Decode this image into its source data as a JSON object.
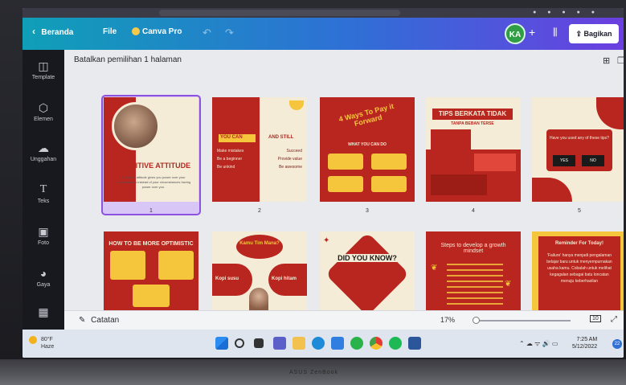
{
  "topbar": {
    "home_label": "Beranda",
    "file_label": "File",
    "pro_label": "Canva Pro",
    "avatar_initials": "KA",
    "share_label": "Bagikan"
  },
  "sidebar": {
    "items": [
      {
        "label": "Template",
        "icon": "layout-icon"
      },
      {
        "label": "Elemen",
        "icon": "shapes-icon"
      },
      {
        "label": "Unggahan",
        "icon": "upload-icon"
      },
      {
        "label": "Teks",
        "icon": "text-icon"
      },
      {
        "label": "Foto",
        "icon": "photo-icon"
      },
      {
        "label": "Gaya",
        "icon": "palette-icon"
      }
    ]
  },
  "content": {
    "selection_text": "Batalkan pemilihan 1 halaman"
  },
  "pages": [
    {
      "number": "1",
      "title": "A POSITIVE ATTITUDE",
      "body": "A positive attitude gives you power over your circumstances instead of your circumstances having power over you."
    },
    {
      "number": "2",
      "left_heading": "YOU CAN",
      "right_heading": "AND STILL",
      "left_lines": [
        "Make mistakes",
        "Be a beginner",
        "Be unkind"
      ],
      "right_lines": [
        "Succeed",
        "Provide value",
        "Be awesome"
      ]
    },
    {
      "number": "3",
      "title": "4 Ways To Pay it Forward",
      "subtitle": "WHAT YOU CAN DO"
    },
    {
      "number": "4",
      "title": "TIPS BERKATA TIDAK",
      "subtitle": "TANPA BEBAN TERSE"
    },
    {
      "number": "5",
      "question": "Have you used any of these tips?",
      "yes": "YES",
      "no": "NO"
    },
    {
      "number": "6",
      "title": "HOW TO BE MORE OPTIMISTIC"
    },
    {
      "number": "7",
      "title": "Kamu Tim Mana?",
      "left": "Kopi susu",
      "right": "Kopi hitam"
    },
    {
      "number": "8",
      "title": "DID YOU KNOW?"
    },
    {
      "number": "9",
      "title": "Steps to develop a growth mindset"
    },
    {
      "number": "10",
      "title": "Reminder For Today!",
      "body": "'Failure' hanya menjadi pengalaman belajar baru untuk menyempurnakan usaha kamu. Cobalah untuk melihat kegagalan sebagai batu loncatan menuju keberhasilan"
    }
  ],
  "bottombar": {
    "notes_label": "Catatan",
    "zoom": "17%",
    "page_count": "10"
  },
  "taskbar": {
    "temperature": "80°F",
    "weather": "Haze",
    "time": "7:25 AM",
    "date": "5/12/2022",
    "notification_count": "22"
  },
  "brand": "ASUS ZenBook",
  "colors": {
    "brand_red": "#b8261f",
    "brand_cream": "#f4ecd7",
    "brand_yellow": "#f5c53c",
    "selection_purple": "#8d52e0"
  }
}
